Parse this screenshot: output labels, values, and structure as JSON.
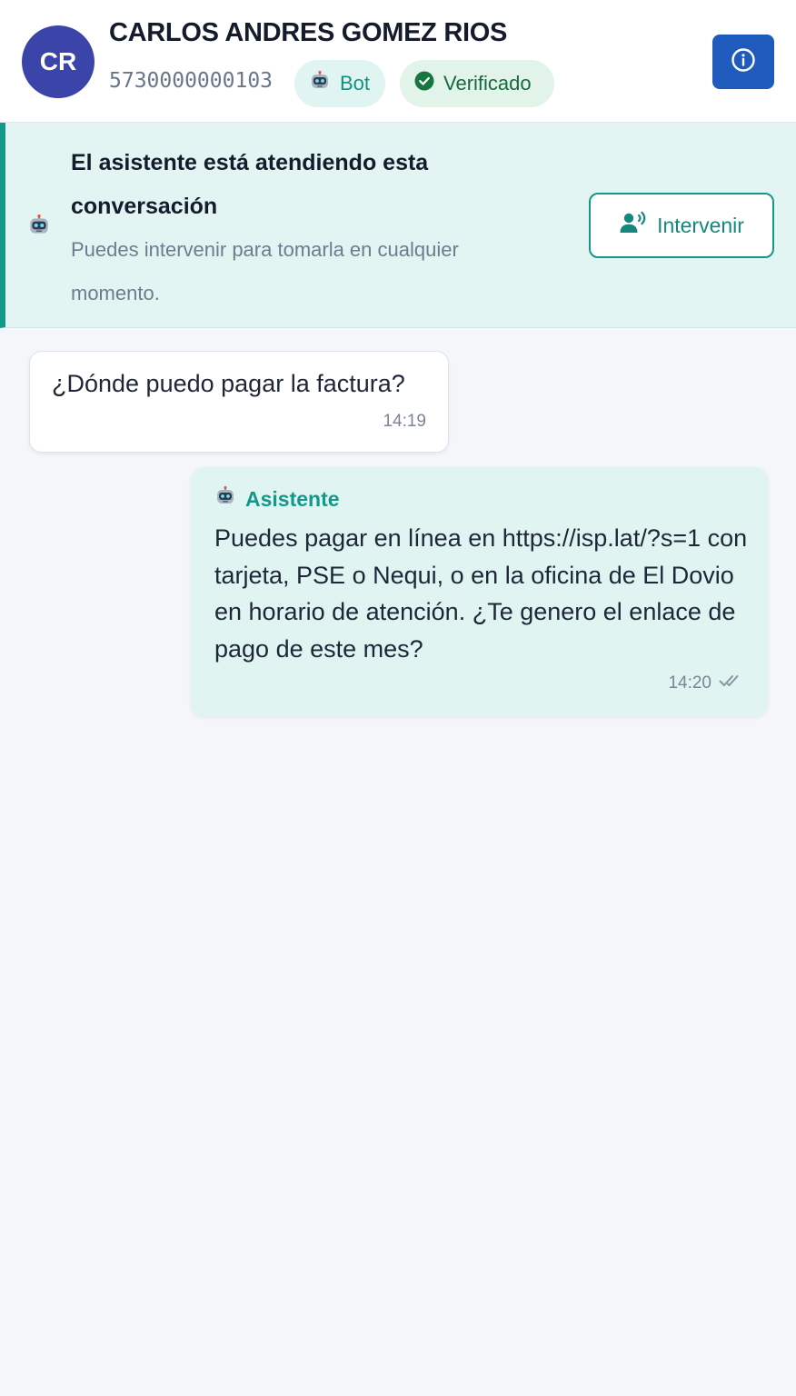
{
  "header": {
    "avatar_initials": "CR",
    "contact_name": "CARLOS ANDRES GOMEZ RIOS",
    "phone": "5730000000103",
    "badges": [
      {
        "label": "Bot",
        "icon": "robot-icon"
      },
      {
        "label": "Verificado",
        "icon": "check-circle-icon"
      }
    ],
    "info_icon": "info-icon"
  },
  "banner": {
    "icon": "robot-icon",
    "title": "El asistente está atendiendo esta conversación",
    "subtitle": "Puedes intervenir para tomarla en cualquier momento.",
    "button_label": "Intervenir",
    "button_icon": "user-voice-icon"
  },
  "messages": [
    {
      "direction": "incoming",
      "text": "¿Dónde puedo pagar la factura?",
      "time": "14:19"
    },
    {
      "direction": "outgoing",
      "sender": "Asistente",
      "sender_icon": "robot-icon",
      "text": "Puedes pagar en línea en https://isp.lat/?s=1 con tarjeta, PSE o Nequi, o en la oficina de El Dovio en horario de atención. ¿Te genero el enlace de pago de este mes?",
      "time": "14:20",
      "status_icon": "double-check-icon"
    }
  ],
  "colors": {
    "accent": "#14988a",
    "primary_button": "#1f5bbd",
    "avatar": "#3b44a8",
    "banner_bg": "#e2f5f3",
    "outgoing_bubble": "#e0f5f2"
  }
}
